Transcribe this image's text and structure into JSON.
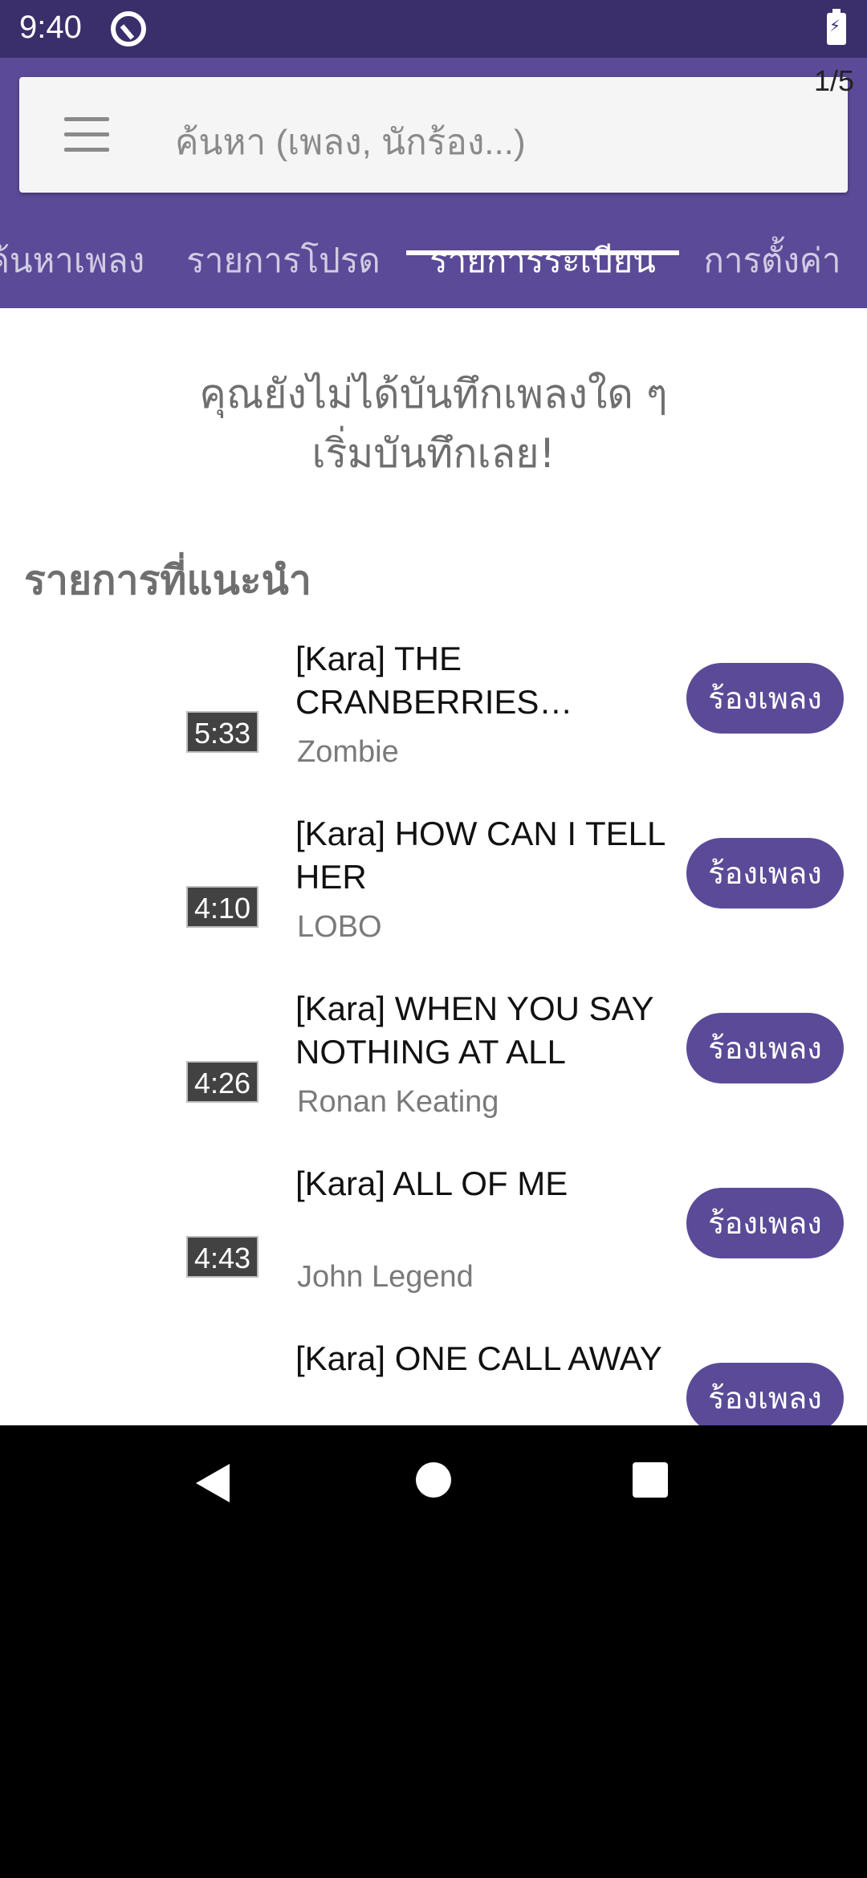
{
  "status_bar": {
    "time": "9:40"
  },
  "page_indicator": "1/5",
  "search": {
    "placeholder": "ค้นหา (เพลง, นักร้อง...)"
  },
  "tabs": [
    {
      "label": "ค้นหาเพลง",
      "active": false
    },
    {
      "label": "รายการโปรด",
      "active": false
    },
    {
      "label": "รายการระเบียน",
      "active": true
    },
    {
      "label": "การตั้งค่า",
      "active": false
    }
  ],
  "empty_message": {
    "line1": "คุณยังไม่ได้บันทึกเพลงใด ๆ",
    "line2": "เริ่มบันทึกเลย!"
  },
  "section_title": "รายการที่แนะนำ",
  "songs": [
    {
      "title": "[Kara] THE CRANBERRIES (ACOUSTIC)",
      "artist": "Zombie",
      "duration": "5:33",
      "button": "ร้องเพลง"
    },
    {
      "title": "[Kara] HOW CAN I TELL HER",
      "artist": "LOBO",
      "duration": "4:10",
      "button": "ร้องเพลง"
    },
    {
      "title": "[Kara] WHEN YOU SAY NOTHING AT ALL",
      "artist": "Ronan Keating",
      "duration": "4:26",
      "button": "ร้องเพลง"
    },
    {
      "title": "[Kara] ALL OF ME",
      "artist": "John Legend",
      "duration": "4:43",
      "button": "ร้องเพลง"
    },
    {
      "title": "[Kara] ONE CALL AWAY",
      "artist": "",
      "duration": "",
      "button": "ร้องเพลง"
    }
  ],
  "colors": {
    "primary": "#5b4a97",
    "status_bar": "#3a2e6b",
    "muted_text": "#6f6f6f"
  },
  "icons": [
    "menu-icon",
    "battery-charging-icon",
    "app-status-icon",
    "back-icon",
    "home-icon",
    "recents-icon"
  ]
}
